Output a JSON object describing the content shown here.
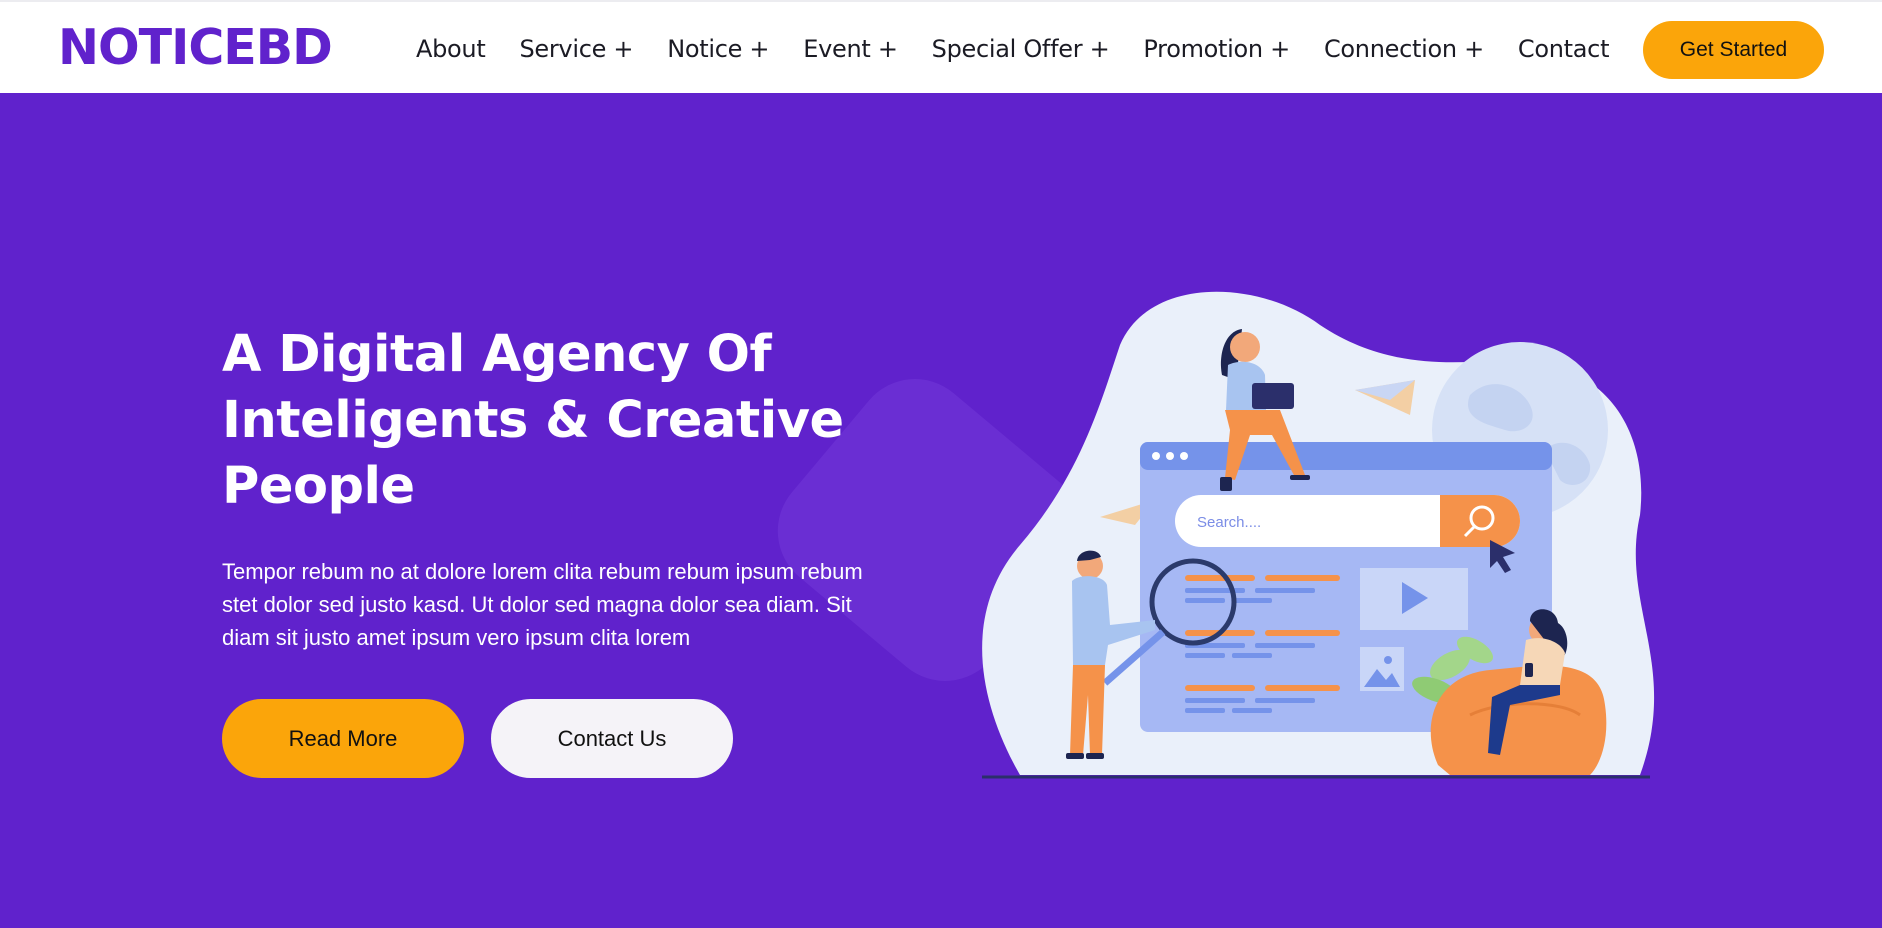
{
  "header": {
    "logo": "NOTICEBD",
    "nav": [
      {
        "label": "About"
      },
      {
        "label": "Service +"
      },
      {
        "label": "Notice +"
      },
      {
        "label": "Event +"
      },
      {
        "label": "Special Offer +"
      },
      {
        "label": "Promotion +"
      },
      {
        "label": "Connection +"
      },
      {
        "label": "Contact"
      }
    ],
    "cta_label": "Get Started"
  },
  "hero": {
    "title": "A Digital Agency Of Inteligents & Creative People",
    "text": "Tempor rebum no at dolore lorem clita rebum rebum ipsum rebum stet dolor sed justo kasd. Ut dolor sed magna dolor sea diam. Sit diam sit justo amet ipsum vero ipsum clita lorem",
    "read_more_label": "Read More",
    "contact_label": "Contact Us"
  },
  "illustration": {
    "search_placeholder": "Search...."
  },
  "colors": {
    "brand": "#6022cc",
    "accent": "#fba50a",
    "white": "#ffffff"
  }
}
